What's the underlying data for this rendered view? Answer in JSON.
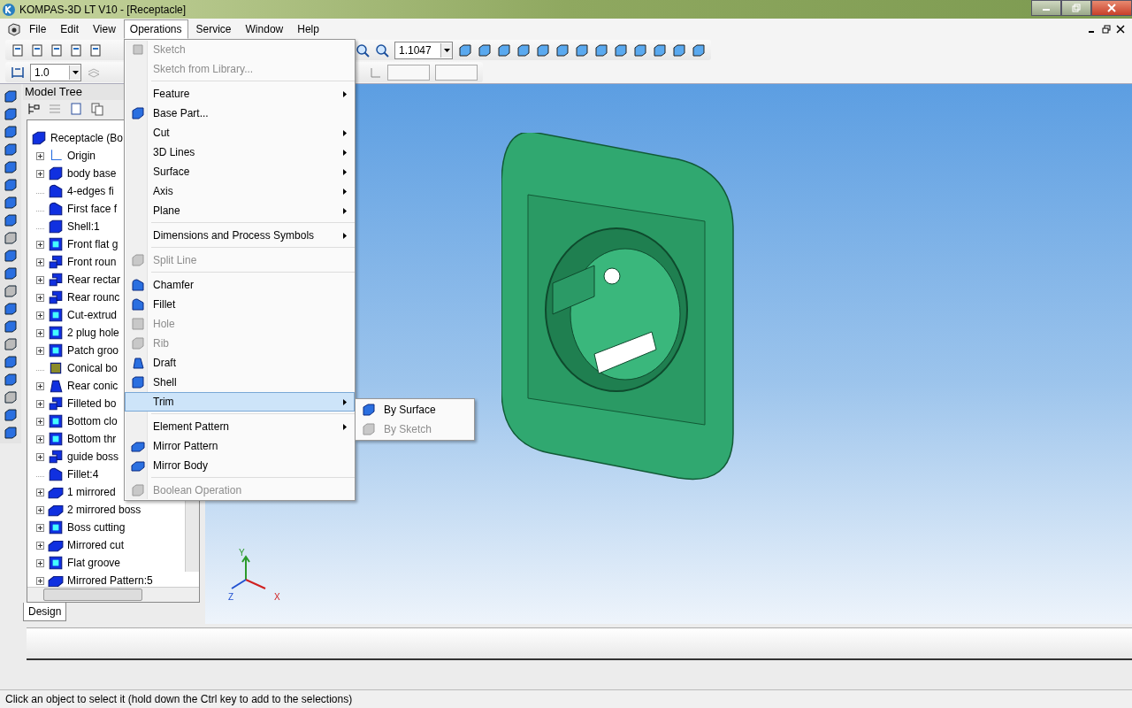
{
  "window": {
    "title": "KOMPAS-3D LT V10 - [Receptacle]"
  },
  "menu_bar": [
    {
      "label": "File",
      "selected": false
    },
    {
      "label": "Edit",
      "selected": false
    },
    {
      "label": "View",
      "selected": false
    },
    {
      "label": "Operations",
      "selected": true
    },
    {
      "label": "Service",
      "selected": false
    },
    {
      "label": "Window",
      "selected": false
    },
    {
      "label": "Help",
      "selected": false
    }
  ],
  "toolbar": {
    "zoom_value": "1.1047",
    "line_scale": "1.0"
  },
  "model_tree": {
    "title": "Model Tree",
    "tab": "Design",
    "items": [
      {
        "label": "Receptacle (Bo",
        "kind": "part",
        "expandable": false
      },
      {
        "label": "Origin",
        "kind": "origin",
        "expandable": true
      },
      {
        "label": "body base",
        "kind": "cube",
        "expandable": true
      },
      {
        "label": "4-edges fi",
        "kind": "fillet",
        "expandable": false
      },
      {
        "label": "First face f",
        "kind": "fillet",
        "expandable": false
      },
      {
        "label": "Shell:1",
        "kind": "shell",
        "expandable": false
      },
      {
        "label": "Front flat g",
        "kind": "cut",
        "expandable": true
      },
      {
        "label": "Front roun",
        "kind": "boss",
        "expandable": true
      },
      {
        "label": "Rear rectar",
        "kind": "boss",
        "expandable": true
      },
      {
        "label": "Rear rounc",
        "kind": "boss",
        "expandable": true
      },
      {
        "label": "Cut-extrud",
        "kind": "cut",
        "expandable": true
      },
      {
        "label": "2 plug hole",
        "kind": "cut",
        "expandable": true
      },
      {
        "label": "Patch groo",
        "kind": "cut",
        "expandable": true
      },
      {
        "label": "Conical bo",
        "kind": "sketch",
        "expandable": false
      },
      {
        "label": "Rear conic",
        "kind": "conic",
        "expandable": true
      },
      {
        "label": "Filleted bo",
        "kind": "boss",
        "expandable": true
      },
      {
        "label": "Bottom clo",
        "kind": "cut",
        "expandable": true
      },
      {
        "label": "Bottom thr",
        "kind": "cut",
        "expandable": true
      },
      {
        "label": "guide boss",
        "kind": "boss",
        "expandable": true
      },
      {
        "label": "Fillet:4",
        "kind": "fillet",
        "expandable": false
      },
      {
        "label": "1 mirrored",
        "kind": "mirror",
        "expandable": true
      },
      {
        "label": "2 mirrored boss",
        "kind": "mirror",
        "expandable": true
      },
      {
        "label": "Boss cutting",
        "kind": "cut",
        "expandable": true
      },
      {
        "label": "Mirrored cut",
        "kind": "mirror",
        "expandable": true
      },
      {
        "label": "Flat groove",
        "kind": "cut",
        "expandable": true
      },
      {
        "label": "Mirrored Pattern:5",
        "kind": "mirror",
        "expandable": true
      }
    ]
  },
  "operations_menu": [
    {
      "kind": "sketch",
      "label": "Sketch",
      "disabled": true,
      "submenu": false,
      "selected": false
    },
    {
      "kind": "plain",
      "label": "Sketch from Library...",
      "disabled": true,
      "submenu": false,
      "selected": false
    },
    {
      "kind": "separator"
    },
    {
      "kind": "plain",
      "label": "Feature",
      "disabled": false,
      "submenu": true,
      "selected": false
    },
    {
      "kind": "part",
      "label": "Base Part...",
      "disabled": false,
      "submenu": false,
      "selected": false
    },
    {
      "kind": "plain",
      "label": "Cut",
      "disabled": false,
      "submenu": true,
      "selected": false
    },
    {
      "kind": "plain",
      "label": "3D Lines",
      "disabled": false,
      "submenu": true,
      "selected": false
    },
    {
      "kind": "plain",
      "label": "Surface",
      "disabled": false,
      "submenu": true,
      "selected": false
    },
    {
      "kind": "plain",
      "label": "Axis",
      "disabled": false,
      "submenu": true,
      "selected": false
    },
    {
      "kind": "plain",
      "label": "Plane",
      "disabled": false,
      "submenu": true,
      "selected": false
    },
    {
      "kind": "separator"
    },
    {
      "kind": "plain",
      "label": "Dimensions and Process Symbols",
      "disabled": false,
      "submenu": true,
      "selected": false
    },
    {
      "kind": "separator"
    },
    {
      "kind": "cube",
      "label": "Split Line",
      "disabled": true,
      "submenu": false,
      "selected": false
    },
    {
      "kind": "separator"
    },
    {
      "kind": "fillet",
      "label": "Chamfer",
      "disabled": false,
      "submenu": false,
      "selected": false
    },
    {
      "kind": "fillet",
      "label": "Fillet",
      "disabled": false,
      "submenu": false,
      "selected": false
    },
    {
      "kind": "cut",
      "label": "Hole",
      "disabled": true,
      "submenu": false,
      "selected": false
    },
    {
      "kind": "cube",
      "label": "Rib",
      "disabled": true,
      "submenu": false,
      "selected": false
    },
    {
      "kind": "conic",
      "label": "Draft",
      "disabled": false,
      "submenu": false,
      "selected": false
    },
    {
      "kind": "shell",
      "label": "Shell",
      "disabled": false,
      "submenu": false,
      "selected": false
    },
    {
      "kind": "plain",
      "label": "Trim",
      "disabled": false,
      "submenu": true,
      "selected": true
    },
    {
      "kind": "separator"
    },
    {
      "kind": "plain",
      "label": "Element Pattern",
      "disabled": false,
      "submenu": true,
      "selected": false
    },
    {
      "kind": "mirror",
      "label": "Mirror Pattern",
      "disabled": false,
      "submenu": false,
      "selected": false
    },
    {
      "kind": "mirror",
      "label": "Mirror Body",
      "disabled": false,
      "submenu": false,
      "selected": false
    },
    {
      "kind": "separator"
    },
    {
      "kind": "cube",
      "label": "Boolean Operation",
      "disabled": true,
      "submenu": false,
      "selected": false
    }
  ],
  "trim_submenu": [
    {
      "label": "By Surface",
      "disabled": false
    },
    {
      "label": "By Sketch",
      "disabled": true
    }
  ],
  "axes": {
    "x": "X",
    "y": "Y",
    "z": "Z"
  },
  "status_bar": "Click an object to select it (hold down the Ctrl key to add to the selections)"
}
